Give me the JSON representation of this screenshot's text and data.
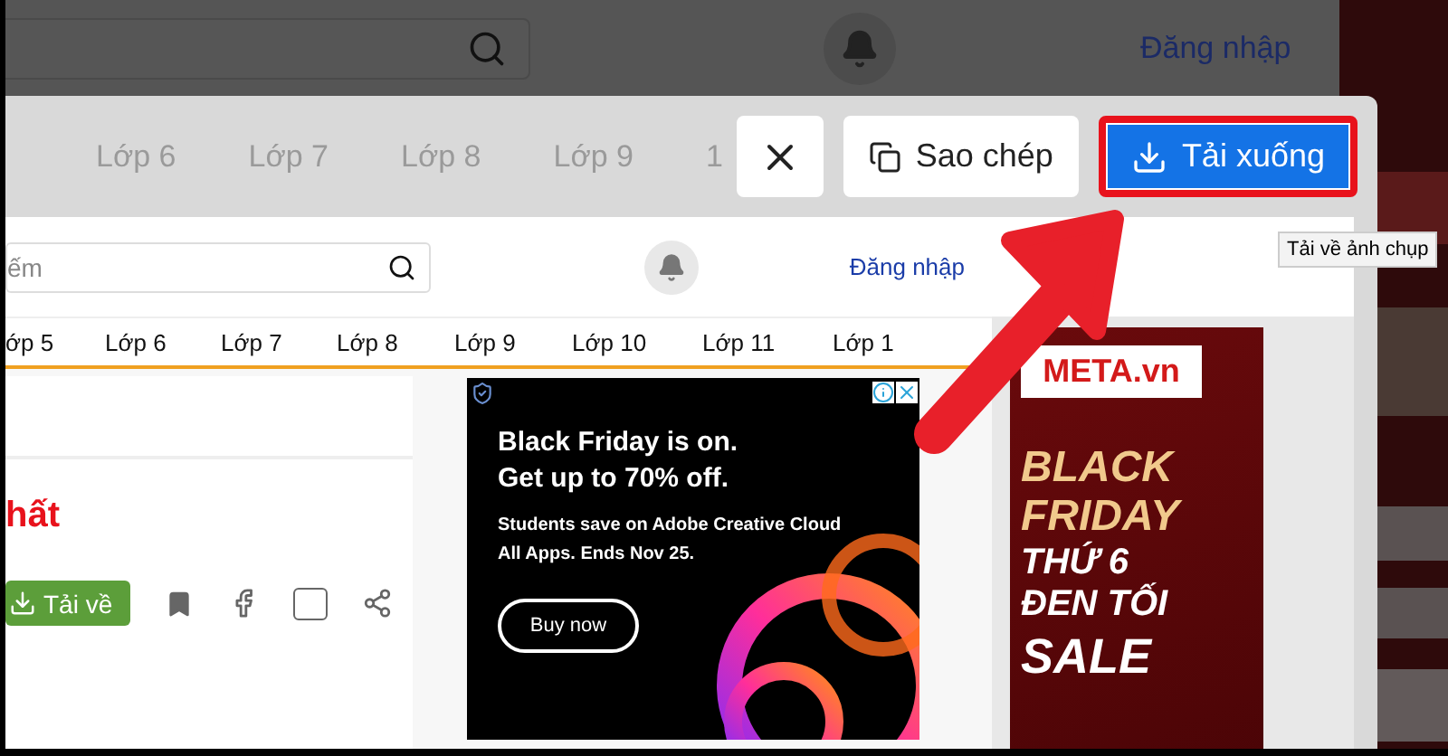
{
  "backdrop": {
    "login": "Đăng nhập"
  },
  "preview": {
    "faded_tabs": [
      "Lớp 6",
      "Lớp 7",
      "Lớp 8",
      "Lớp 9",
      "1"
    ],
    "buttons": [
      {
        "kind": "close",
        "highlighted": false
      },
      {
        "kind": "copy",
        "label": "Sao chép",
        "highlighted": false
      },
      {
        "kind": "download",
        "label": "Tải xuống",
        "highlighted": true
      }
    ],
    "tooltip": "Tải về ảnh chụp"
  },
  "page": {
    "search": {
      "placeholder": "ếm"
    },
    "login": "Đăng nhập",
    "nav": [
      "ớp 5",
      "Lớp 6",
      "Lớp 7",
      "Lớp 8",
      "Lớp 9",
      "Lớp 10",
      "Lớp 11",
      "Lớp 1"
    ],
    "title": "hất",
    "download_button": "Tải về",
    "ad": {
      "headline": [
        "Black Friday is on.",
        "Get up to 70% off."
      ],
      "body": [
        "Students save on Adobe Creative Cloud",
        "All Apps. Ends Nov 25."
      ],
      "cta": "Buy now"
    },
    "side_ad": {
      "logo": "META.vn",
      "lines": [
        {
          "kind": "gold",
          "text": "BLACK"
        },
        {
          "kind": "gold",
          "text": "FRIDAY"
        },
        {
          "kind": "white",
          "text": "THỨ 6"
        },
        {
          "kind": "white",
          "text": "ĐEN TỐI"
        },
        {
          "kind": "big",
          "text": "SALE"
        }
      ]
    }
  }
}
